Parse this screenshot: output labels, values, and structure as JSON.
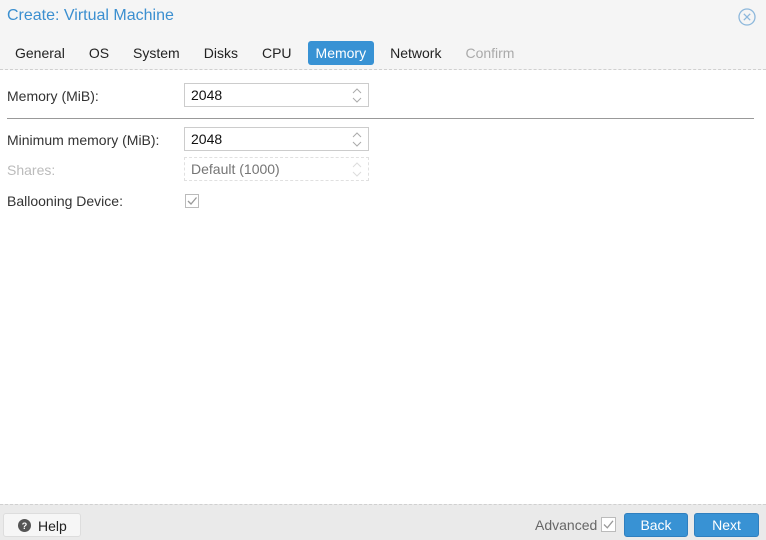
{
  "window": {
    "title": "Create: Virtual Machine",
    "close_icon": "close-circle-icon"
  },
  "tabs": [
    {
      "label": "General",
      "state": "normal"
    },
    {
      "label": "OS",
      "state": "normal"
    },
    {
      "label": "System",
      "state": "normal"
    },
    {
      "label": "Disks",
      "state": "normal"
    },
    {
      "label": "CPU",
      "state": "normal"
    },
    {
      "label": "Memory",
      "state": "active"
    },
    {
      "label": "Network",
      "state": "normal"
    },
    {
      "label": "Confirm",
      "state": "disabled"
    }
  ],
  "form": {
    "memory": {
      "label": "Memory (MiB):",
      "value": "2048"
    },
    "min_memory": {
      "label": "Minimum memory (MiB):",
      "value": "2048"
    },
    "shares": {
      "label": "Shares:",
      "placeholder": "Default (1000)",
      "disabled": true
    },
    "ballooning": {
      "label": "Ballooning Device:",
      "checked": true
    }
  },
  "footer": {
    "help_label": "Help",
    "advanced_label": "Advanced",
    "advanced_checked": true,
    "back_label": "Back",
    "next_label": "Next"
  },
  "colors": {
    "accent": "#3892d4",
    "title": "#3b8fd0"
  }
}
